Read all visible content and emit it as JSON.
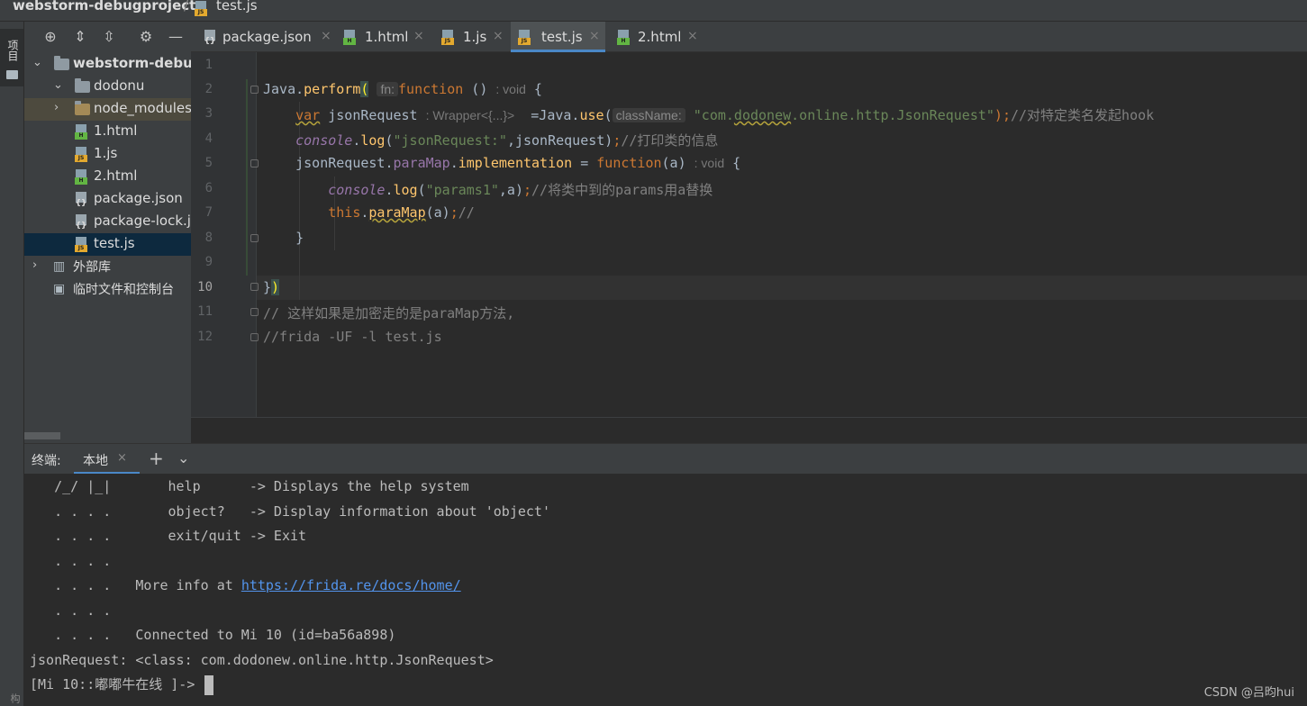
{
  "breadcrumb": {
    "project": "webstorm-debugproject",
    "separator": "/",
    "file": "test.js"
  },
  "left_strip": {
    "project_tab": "项目",
    "bottom_tab": "结构"
  },
  "project_tree": [
    {
      "label": "webstorm-debugproject",
      "type": "folder",
      "expanded": true
    },
    {
      "label": "dodonu",
      "type": "folder",
      "expanded": true
    },
    {
      "label": "node_modules",
      "type": "folder",
      "expanded": false,
      "note": "library root"
    },
    {
      "label": "1.html",
      "type": "html"
    },
    {
      "label": "1.js",
      "type": "js"
    },
    {
      "label": "2.html",
      "type": "html"
    },
    {
      "label": "package.json",
      "type": "json"
    },
    {
      "label": "package-lock.json",
      "type": "json"
    },
    {
      "label": "test.js",
      "type": "js",
      "selected": true
    },
    {
      "label": "外部库",
      "type": "library"
    },
    {
      "label": "临时文件和控制台",
      "type": "scratch"
    }
  ],
  "tabs": [
    {
      "label": "package.json",
      "type": "json",
      "close": "×"
    },
    {
      "label": "1.html",
      "type": "html",
      "close": "×"
    },
    {
      "label": "1.js",
      "type": "js",
      "close": "×"
    },
    {
      "label": "test.js",
      "type": "js",
      "close": "×",
      "active": true
    },
    {
      "label": "2.html",
      "type": "html",
      "close": "×"
    }
  ],
  "file_badges": {
    "html": "H",
    "js": "JS",
    "json": "{}"
  },
  "editor": {
    "line_numbers": [
      "1",
      "2",
      "3",
      "4",
      "5",
      "6",
      "7",
      "8",
      "9",
      "10",
      "11",
      "12"
    ],
    "current_line": "10",
    "tokens": {
      "l2_java": "Java",
      "l2_dot": ".",
      "l2_perform": "perform",
      "l2_paren": "(",
      "l2_hint": "fn:",
      "l2_function": "function",
      "l2_args": " ()",
      "l2_void": ": void",
      "l2_brace": " {",
      "l3_var": "var",
      "l3_name": " jsonRequest ",
      "l3_hint": ": Wrapper<{...}>",
      "l3_eq": "  =Java.",
      "l3_use": "use",
      "l3_paren": "(",
      "l3_hint2": "className:",
      "l3_str_a": "\"com.",
      "l3_str_b": "dodonew",
      "l3_str_c": ".online.http.JsonRequest\"",
      "l3_end": ");",
      "l3_comment": "//对特定类名发起hook",
      "l4_console": "console",
      "l4_dot": ".",
      "l4_log": "log",
      "l4_paren": "(",
      "l4_str": "\"jsonRequest:\"",
      "l4_rest": ",jsonRequest)",
      "l4_semi": ";",
      "l4_comment": "//打印类的信息",
      "l5_obj": "jsonRequest.",
      "l5_prop": "paraMap",
      "l5_dot": ".",
      "l5_impl": "implementation",
      "l5_eq": " = ",
      "l5_function": "function",
      "l5_args": "(a) ",
      "l5_void": ": void",
      "l5_brace": " {",
      "l6_console": "console",
      "l6_dot": ".",
      "l6_log": "log",
      "l6_paren": "(",
      "l6_str": "\"params1\"",
      "l6_rest": ",a)",
      "l6_semi": ";",
      "l6_comment": "//将类中到的params用a替换",
      "l7_this": "this",
      "l7_dot": ".",
      "l7_method": "paraMap",
      "l7_args": "(a)",
      "l7_semi": ";",
      "l7_comment": "//",
      "l8_brace": "}",
      "l10_brace": "}",
      "l10_paren": ")",
      "l11_comment": "// 这样如果是加密走的是paraMap方法,",
      "l12_comment": "//frida -UF -l test.js"
    }
  },
  "terminal": {
    "label": "终端:",
    "tab": "本地",
    "tab_close": "×",
    "add": "+",
    "menu": "⌄",
    "lines": [
      "   /_/ |_|       help      -> Displays the help system",
      "   . . . .       object?   -> Display information about 'object'",
      "   . . . .       exit/quit -> Exit",
      "   . . . .",
      "   . . . .   More info at ",
      "   . . . .",
      "   . . . .   Connected to Mi 10 (id=ba56a898)",
      "jsonRequest: <class: com.dodonew.online.http.JsonRequest>",
      "[Mi 10::嘟嘟牛在线 ]-> "
    ],
    "link": "https://frida.re/docs/home/"
  },
  "watermark": "CSDN @吕昀hui",
  "colors": {
    "keyword": "#cc7832",
    "function_name": "#ffc66d",
    "string": "#6a8759",
    "comment": "#808080",
    "field": "#9876aa",
    "accent": "#4a88c7"
  }
}
